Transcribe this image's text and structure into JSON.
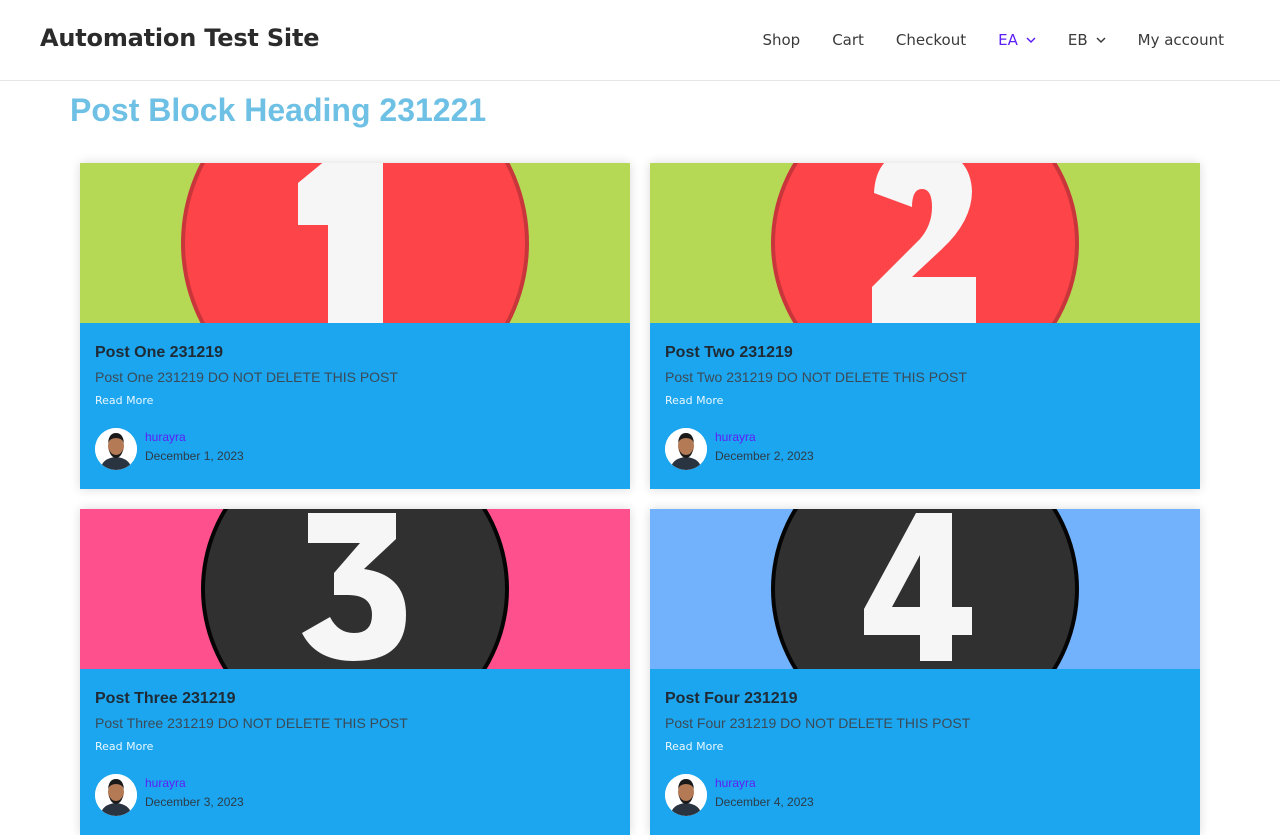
{
  "header": {
    "site_title": "Automation Test Site",
    "nav": [
      {
        "label": "Shop",
        "has_dropdown": false,
        "active": false
      },
      {
        "label": "Cart",
        "has_dropdown": false,
        "active": false
      },
      {
        "label": "Checkout",
        "has_dropdown": false,
        "active": false
      },
      {
        "label": "EA",
        "has_dropdown": true,
        "active": true
      },
      {
        "label": "EB",
        "has_dropdown": true,
        "active": false
      },
      {
        "label": "My account",
        "has_dropdown": false,
        "active": false
      }
    ]
  },
  "main": {
    "heading": "Post Block Heading 231221",
    "posts": [
      {
        "title": "Post One 231219",
        "excerpt": "Post One 231219 DO NOT DELETE THIS POST",
        "read_more": "Read More",
        "author": "hurayra",
        "date": "December 1, 2023",
        "thumb_number": "1",
        "thumb_bg": "#b5d955",
        "thumb_circle": "#fd4448",
        "thumb_ring": "#c8353a"
      },
      {
        "title": "Post Two 231219",
        "excerpt": "Post Two 231219 DO NOT DELETE THIS POST",
        "read_more": "Read More",
        "author": "hurayra",
        "date": "December 2, 2023",
        "thumb_number": "2",
        "thumb_bg": "#b5d955",
        "thumb_circle": "#fd4448",
        "thumb_ring": "#c8353a"
      },
      {
        "title": "Post Three 231219",
        "excerpt": "Post Three 231219 DO NOT DELETE THIS POST",
        "read_more": "Read More",
        "author": "hurayra",
        "date": "December 3, 2023",
        "thumb_number": "3",
        "thumb_bg": "#fd508d",
        "thumb_circle": "#303030",
        "thumb_ring": "#050505"
      },
      {
        "title": "Post Four 231219",
        "excerpt": "Post Four 231219 DO NOT DELETE THIS POST",
        "read_more": "Read More",
        "author": "hurayra",
        "date": "December 4, 2023",
        "thumb_number": "4",
        "thumb_bg": "#72b1fb",
        "thumb_circle": "#303030",
        "thumb_ring": "#050505"
      }
    ]
  },
  "colors": {
    "accent": "#5e1ff5",
    "heading": "#6ec1e4",
    "card_bg": "#1ba6ef",
    "read_more": "#e9f7ff"
  },
  "icons": {
    "dropdown": "chevron-down-icon",
    "avatar": "author-avatar"
  }
}
